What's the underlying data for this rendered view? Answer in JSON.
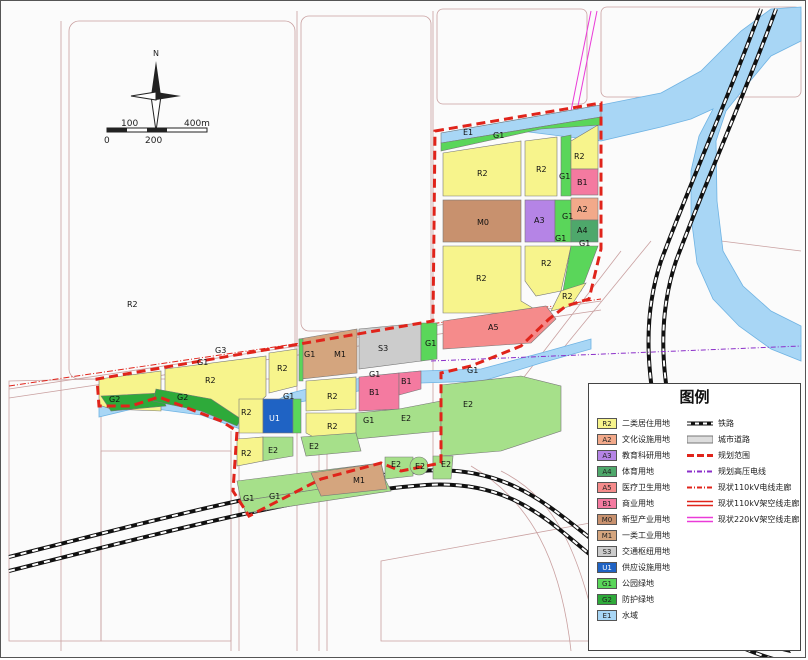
{
  "compass": {
    "north_label": "N"
  },
  "scale_bar": {
    "top_labels": [
      "100",
      "400m"
    ],
    "bottom_labels": [
      "0",
      "200"
    ]
  },
  "legend": {
    "title": "图例",
    "land_use": [
      {
        "code": "R2",
        "label": "二类居住用地",
        "color": "#f7f48c"
      },
      {
        "code": "A2",
        "label": "文化设施用地",
        "color": "#f2a98a"
      },
      {
        "code": "A3",
        "label": "教育科研用地",
        "color": "#b584e6"
      },
      {
        "code": "A4",
        "label": "体育用地",
        "color": "#4ea86b"
      },
      {
        "code": "A5",
        "label": "医疗卫生用地",
        "color": "#f58b8b"
      },
      {
        "code": "B1",
        "label": "商业用地",
        "color": "#f47aa0"
      },
      {
        "code": "M0",
        "label": "新型产业用地",
        "color": "#c8916e"
      },
      {
        "code": "M1",
        "label": "一类工业用地",
        "color": "#d4a57e"
      },
      {
        "code": "S3",
        "label": "交通枢纽用地",
        "color": "#cccccc"
      },
      {
        "code": "U1",
        "label": "供应设施用地",
        "color": "#1f63c4"
      },
      {
        "code": "G1",
        "label": "公园绿地",
        "color": "#5ad65a"
      },
      {
        "code": "G2",
        "label": "防护绿地",
        "color": "#2eaa3a"
      },
      {
        "code": "E1",
        "label": "水域",
        "color": "#a8d6f5"
      }
    ],
    "line_types": [
      {
        "label": "铁路",
        "color": "#111111",
        "style": "railway"
      },
      {
        "label": "城市道路",
        "color": "#777777",
        "style": "road"
      },
      {
        "label": "规划范围",
        "color": "#e0241b",
        "style": "dash"
      },
      {
        "label": "规划高压电线",
        "color": "#8b2fc9",
        "style": "dashdot"
      },
      {
        "label": "现状110kV电线走廊",
        "color": "#e0241b",
        "style": "dashdot"
      },
      {
        "label": "现状110kV架空线走廊",
        "color": "#e0241b",
        "style": "double"
      },
      {
        "label": "现状220kV架空线走廊",
        "color": "#ea3bd8",
        "style": "double"
      }
    ]
  },
  "parcel_labels": {
    "e1": "E1",
    "g1_top": "G1",
    "r2_nw": "R2",
    "r2_n2": "R2",
    "r2_ne": "R2",
    "b1_ne": "B1",
    "g1_n1": "G1",
    "m0": "M0",
    "a3": "A3",
    "a2": "A2",
    "g1_n2": "G1",
    "a4": "A4",
    "g1_n3": "G1",
    "g1_n4": "G1",
    "r2_c1": "R2",
    "r2_c2": "R2",
    "r2_c3": "R2",
    "a5": "A5",
    "m1_n": "M1",
    "s3": "S3",
    "g1_m1": "G1",
    "g1_m2": "G1",
    "g1_m3": "G1",
    "r2_w1": "R2",
    "r2_w2": "R2",
    "g2_w": "G2",
    "g2_w2": "G2",
    "g3": "G3",
    "g1_w": "G1",
    "r2_m1": "R2",
    "r2_m2": "R2",
    "r2_m3": "R2",
    "b1_m1": "B1",
    "b1_m2": "B1",
    "g1_m4": "G1",
    "g1_m5": "G1",
    "u1": "U1",
    "g1_u": "G1",
    "r2_s1": "R2",
    "r2_s2": "R2",
    "e2_1": "E2",
    "e2_2": "E2",
    "e2_3": "E2",
    "e2_4": "E2",
    "e2_5": "E2",
    "e2_6": "E2",
    "g1_s": "G1",
    "m1_s": "M1",
    "e2_7": "E2",
    "g1_r": "G1"
  }
}
